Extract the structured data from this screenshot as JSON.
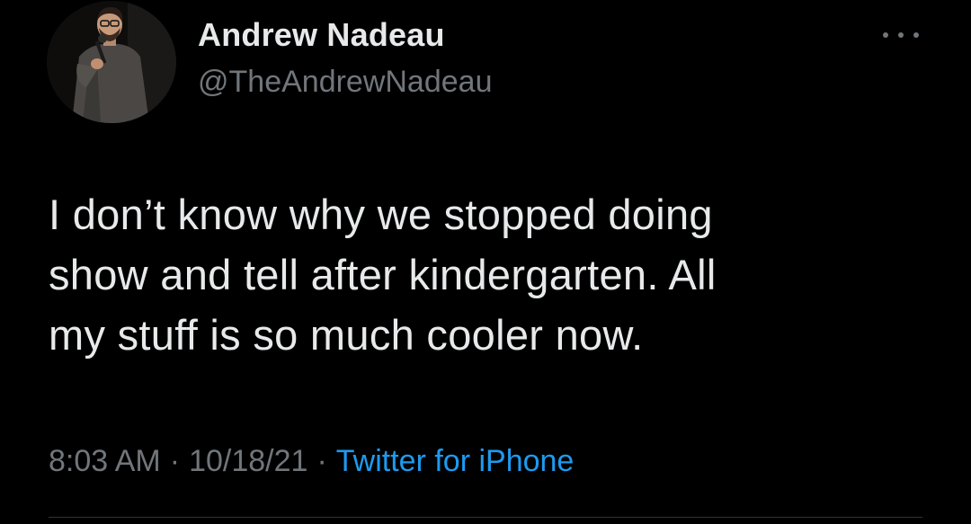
{
  "tweet": {
    "author": {
      "name": "Andrew Nadeau",
      "handle": "@TheAndrewNadeau"
    },
    "text": "I don’t know why we stopped doing\nshow and tell after kindergarten. All\nmy stuff is so much cooler now.",
    "time": "8:03 AM",
    "separator": "·",
    "date": "10/18/21",
    "source": "Twitter for iPhone"
  },
  "icons": {
    "more": "more-horizontal-icon"
  },
  "colors": {
    "background": "#000000",
    "primary_text": "#e7e9ea",
    "secondary_text": "#71767b",
    "link": "#1d9bf0",
    "divider": "#2f3336"
  }
}
